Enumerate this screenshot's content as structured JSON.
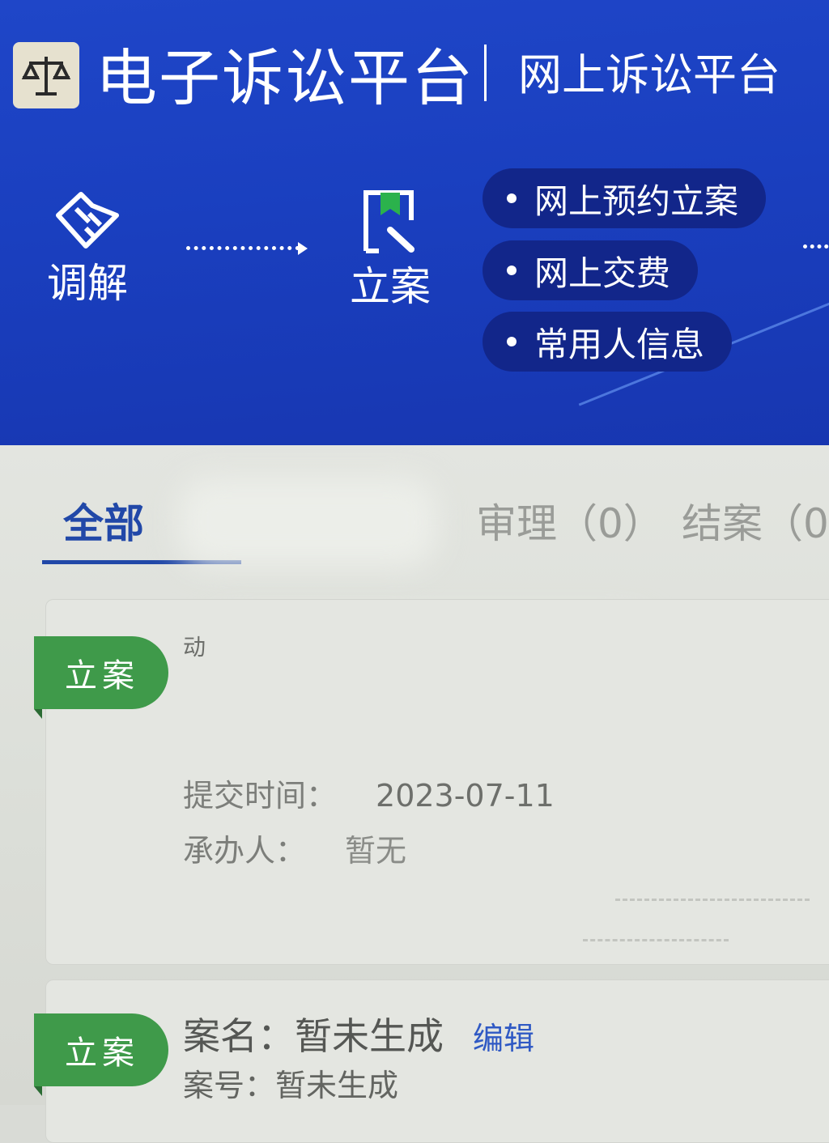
{
  "header": {
    "platform_title": "电子诉讼平台",
    "sub_title": "网上诉讼平台",
    "steps": [
      {
        "label": "调解",
        "icon": "handshake-icon"
      },
      {
        "label": "立案",
        "icon": "filing-flag-icon"
      }
    ],
    "quick_links": [
      {
        "label": "网上预约立案"
      },
      {
        "label": "网上交费"
      },
      {
        "label": "常用人信息"
      }
    ]
  },
  "tabs": [
    {
      "label": "全部",
      "active": true
    },
    {
      "label": "审理（0）"
    },
    {
      "label": "结案（0"
    }
  ],
  "cases": [
    {
      "status": "立案",
      "fragment": "动",
      "submit_label": "提交时间：",
      "submit_value": "2023-07-11",
      "handler_label": "承办人：",
      "handler_value": "暂无"
    },
    {
      "status": "立案",
      "name_label": "案名：",
      "name_value": "暂未生成",
      "edit_label": "编辑",
      "number_label": "案号：",
      "number_value": "暂未生成"
    }
  ],
  "colors": {
    "header_blue": "#1a3fbf",
    "pill_navy": "#12268a",
    "status_green": "#3f9a4a",
    "tab_active": "#2148a8",
    "link_blue": "#2f59c4"
  }
}
